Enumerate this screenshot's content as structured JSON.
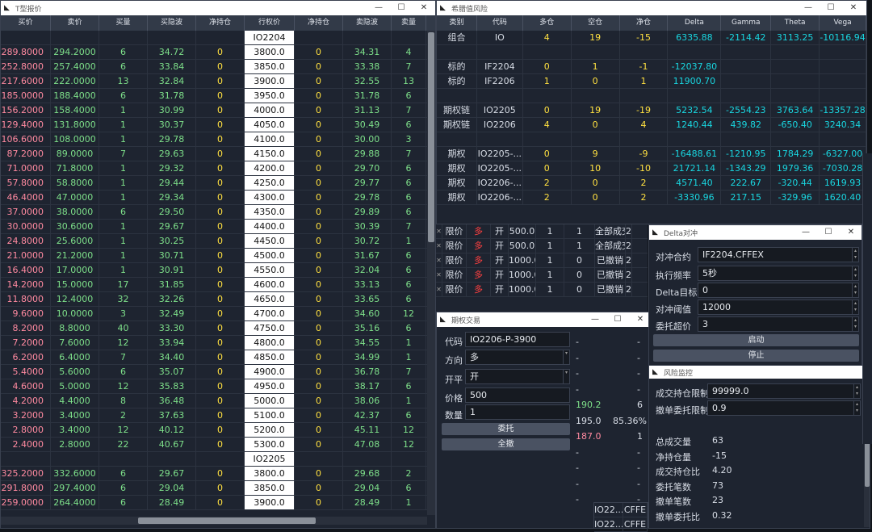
{
  "quote_window": {
    "title": "T型报价",
    "columns": [
      "买价",
      "卖价",
      "买量",
      "买隐波",
      "净持仓",
      "行权价",
      "净持仓",
      "卖隐波",
      "卖量"
    ],
    "rows": [
      {
        "bid": "",
        "ask": "",
        "bidvol": "",
        "biv": "",
        "pos": "",
        "strike": "IO2204",
        "pos2": "",
        "aiv": "",
        "askvol": "",
        "header": true
      },
      {
        "bid": "289.8000",
        "ask": "294.2000",
        "bidvol": "6",
        "biv": "34.72",
        "pos": "0",
        "strike": "3800.0",
        "pos2": "0",
        "aiv": "34.31",
        "askvol": "4"
      },
      {
        "bid": "252.8000",
        "ask": "257.4000",
        "bidvol": "6",
        "biv": "33.84",
        "pos": "0",
        "strike": "3850.0",
        "pos2": "0",
        "aiv": "33.38",
        "askvol": "7"
      },
      {
        "bid": "217.6000",
        "ask": "222.0000",
        "bidvol": "13",
        "biv": "32.84",
        "pos": "0",
        "strike": "3900.0",
        "pos2": "0",
        "aiv": "32.55",
        "askvol": "13"
      },
      {
        "bid": "185.0000",
        "ask": "188.4000",
        "bidvol": "6",
        "biv": "31.78",
        "pos": "0",
        "strike": "3950.0",
        "pos2": "0",
        "aiv": "31.78",
        "askvol": "6"
      },
      {
        "bid": "156.2000",
        "ask": "158.4000",
        "bidvol": "1",
        "biv": "30.99",
        "pos": "0",
        "strike": "4000.0",
        "pos2": "0",
        "aiv": "31.13",
        "askvol": "7"
      },
      {
        "bid": "129.4000",
        "ask": "131.8000",
        "bidvol": "1",
        "biv": "30.37",
        "pos": "0",
        "strike": "4050.0",
        "pos2": "0",
        "aiv": "30.49",
        "askvol": "6"
      },
      {
        "bid": "106.6000",
        "ask": "108.0000",
        "bidvol": "1",
        "biv": "29.78",
        "pos": "0",
        "strike": "4100.0",
        "pos2": "0",
        "aiv": "30.00",
        "askvol": "3"
      },
      {
        "bid": "87.2000",
        "ask": "89.0000",
        "bidvol": "7",
        "biv": "29.63",
        "pos": "0",
        "strike": "4150.0",
        "pos2": "0",
        "aiv": "29.88",
        "askvol": "7"
      },
      {
        "bid": "71.0000",
        "ask": "71.8000",
        "bidvol": "1",
        "biv": "29.32",
        "pos": "0",
        "strike": "4200.0",
        "pos2": "0",
        "aiv": "29.70",
        "askvol": "6"
      },
      {
        "bid": "57.8000",
        "ask": "58.8000",
        "bidvol": "1",
        "biv": "29.44",
        "pos": "0",
        "strike": "4250.0",
        "pos2": "0",
        "aiv": "29.77",
        "askvol": "6"
      },
      {
        "bid": "46.4000",
        "ask": "47.0000",
        "bidvol": "1",
        "biv": "29.34",
        "pos": "0",
        "strike": "4300.0",
        "pos2": "0",
        "aiv": "29.78",
        "askvol": "6"
      },
      {
        "bid": "37.0000",
        "ask": "38.0000",
        "bidvol": "6",
        "biv": "29.50",
        "pos": "0",
        "strike": "4350.0",
        "pos2": "0",
        "aiv": "29.89",
        "askvol": "6"
      },
      {
        "bid": "30.0000",
        "ask": "30.6000",
        "bidvol": "1",
        "biv": "29.67",
        "pos": "0",
        "strike": "4400.0",
        "pos2": "0",
        "aiv": "30.39",
        "askvol": "7"
      },
      {
        "bid": "24.8000",
        "ask": "25.6000",
        "bidvol": "1",
        "biv": "30.25",
        "pos": "0",
        "strike": "4450.0",
        "pos2": "0",
        "aiv": "30.72",
        "askvol": "1"
      },
      {
        "bid": "21.0000",
        "ask": "21.2000",
        "bidvol": "1",
        "biv": "30.71",
        "pos": "0",
        "strike": "4500.0",
        "pos2": "0",
        "aiv": "31.67",
        "askvol": "6"
      },
      {
        "bid": "16.4000",
        "ask": "17.0000",
        "bidvol": "1",
        "biv": "30.91",
        "pos": "0",
        "strike": "4550.0",
        "pos2": "0",
        "aiv": "32.04",
        "askvol": "6"
      },
      {
        "bid": "14.2000",
        "ask": "15.0000",
        "bidvol": "17",
        "biv": "31.85",
        "pos": "0",
        "strike": "4600.0",
        "pos2": "0",
        "aiv": "33.13",
        "askvol": "6"
      },
      {
        "bid": "11.8000",
        "ask": "12.4000",
        "bidvol": "32",
        "biv": "32.26",
        "pos": "0",
        "strike": "4650.0",
        "pos2": "0",
        "aiv": "33.65",
        "askvol": "6"
      },
      {
        "bid": "9.6000",
        "ask": "10.0000",
        "bidvol": "3",
        "biv": "32.49",
        "pos": "0",
        "strike": "4700.0",
        "pos2": "0",
        "aiv": "34.60",
        "askvol": "12"
      },
      {
        "bid": "8.2000",
        "ask": "8.8000",
        "bidvol": "40",
        "biv": "33.30",
        "pos": "0",
        "strike": "4750.0",
        "pos2": "0",
        "aiv": "35.16",
        "askvol": "6"
      },
      {
        "bid": "7.2000",
        "ask": "7.6000",
        "bidvol": "12",
        "biv": "33.94",
        "pos": "0",
        "strike": "4800.0",
        "pos2": "0",
        "aiv": "34.55",
        "askvol": "1"
      },
      {
        "bid": "6.2000",
        "ask": "6.4000",
        "bidvol": "7",
        "biv": "34.40",
        "pos": "0",
        "strike": "4850.0",
        "pos2": "0",
        "aiv": "34.99",
        "askvol": "1"
      },
      {
        "bid": "5.4000",
        "ask": "5.6000",
        "bidvol": "6",
        "biv": "35.07",
        "pos": "0",
        "strike": "4900.0",
        "pos2": "0",
        "aiv": "36.78",
        "askvol": "7"
      },
      {
        "bid": "4.6000",
        "ask": "5.0000",
        "bidvol": "12",
        "biv": "35.83",
        "pos": "0",
        "strike": "4950.0",
        "pos2": "0",
        "aiv": "38.17",
        "askvol": "6"
      },
      {
        "bid": "4.2000",
        "ask": "4.4000",
        "bidvol": "8",
        "biv": "36.48",
        "pos": "0",
        "strike": "5000.0",
        "pos2": "0",
        "aiv": "38.06",
        "askvol": "1"
      },
      {
        "bid": "3.2000",
        "ask": "3.4000",
        "bidvol": "2",
        "biv": "37.63",
        "pos": "0",
        "strike": "5100.0",
        "pos2": "0",
        "aiv": "42.37",
        "askvol": "6"
      },
      {
        "bid": "2.8000",
        "ask": "3.4000",
        "bidvol": "12",
        "biv": "40.12",
        "pos": "0",
        "strike": "5200.0",
        "pos2": "0",
        "aiv": "45.11",
        "askvol": "12"
      },
      {
        "bid": "2.4000",
        "ask": "2.8000",
        "bidvol": "22",
        "biv": "40.67",
        "pos": "0",
        "strike": "5300.0",
        "pos2": "0",
        "aiv": "47.08",
        "askvol": "12"
      },
      {
        "bid": "",
        "ask": "",
        "bidvol": "",
        "biv": "",
        "pos": "",
        "strike": "IO2205",
        "pos2": "",
        "aiv": "",
        "askvol": "",
        "header": true
      },
      {
        "bid": "325.2000",
        "ask": "332.6000",
        "bidvol": "6",
        "biv": "29.67",
        "pos": "0",
        "strike": "3800.0",
        "pos2": "0",
        "aiv": "29.68",
        "askvol": "2"
      },
      {
        "bid": "291.8000",
        "ask": "297.4000",
        "bidvol": "6",
        "biv": "29.04",
        "pos": "0",
        "strike": "3850.0",
        "pos2": "0",
        "aiv": "29.04",
        "askvol": "6"
      },
      {
        "bid": "259.0000",
        "ask": "264.4000",
        "bidvol": "6",
        "biv": "28.49",
        "pos": "0",
        "strike": "3900.0",
        "pos2": "0",
        "aiv": "28.49",
        "askvol": "1"
      }
    ]
  },
  "greeks_window": {
    "title": "希腊值风险",
    "columns": [
      "类别",
      "代码",
      "多仓",
      "空仓",
      "净仓",
      "Delta",
      "Gamma",
      "Theta",
      "Vega"
    ],
    "rows": [
      [
        "组合",
        "IO",
        "4",
        "19",
        "-15",
        "6335.88",
        "-2114.42",
        "3113.25",
        "-10116.94"
      ],
      [
        "",
        "",
        "",
        "",
        "",
        "",
        "",
        "",
        ""
      ],
      [
        "标的",
        "IF2204",
        "0",
        "1",
        "-1",
        "-12037.80",
        "",
        "",
        ""
      ],
      [
        "标的",
        "IF2206",
        "1",
        "0",
        "1",
        "11900.70",
        "",
        "",
        ""
      ],
      [
        "",
        "",
        "",
        "",
        "",
        "",
        "",
        "",
        ""
      ],
      [
        "期权链",
        "IO2205",
        "0",
        "19",
        "-19",
        "5232.54",
        "-2554.23",
        "3763.64",
        "-13357.28"
      ],
      [
        "期权链",
        "IO2206",
        "4",
        "0",
        "4",
        "1240.44",
        "439.82",
        "-650.40",
        "3240.34"
      ],
      [
        "",
        "",
        "",
        "",
        "",
        "",
        "",
        "",
        ""
      ],
      [
        "期权",
        "IO2205-...",
        "0",
        "9",
        "-9",
        "-16488.61",
        "-1210.95",
        "1784.29",
        "-6327.00"
      ],
      [
        "期权",
        "IO2205-...",
        "0",
        "10",
        "-10",
        "21721.14",
        "-1343.29",
        "1979.36",
        "-7030.28"
      ],
      [
        "期权",
        "IO2206-...",
        "2",
        "0",
        "2",
        "4571.40",
        "222.67",
        "-320.44",
        "1619.93"
      ],
      [
        "期权",
        "IO2206-...",
        "2",
        "0",
        "2",
        "-3330.96",
        "217.15",
        "-329.96",
        "1620.40"
      ]
    ]
  },
  "orders": {
    "rows": [
      [
        "限价",
        "多",
        "开",
        "500.0",
        "1",
        "1",
        "全部成交",
        "2"
      ],
      [
        "限价",
        "多",
        "开",
        "500.0",
        "1",
        "1",
        "全部成交",
        "2"
      ],
      [
        "限价",
        "多",
        "开",
        "1000.0",
        "1",
        "0",
        "已撤销",
        "2"
      ],
      [
        "限价",
        "多",
        "开",
        "1000.0",
        "1",
        "0",
        "已撤销",
        "2"
      ],
      [
        "限价",
        "多",
        "开",
        "1000.0",
        "1",
        "0",
        "已撤销",
        "2"
      ]
    ]
  },
  "trade_window": {
    "title": "期权交易",
    "code_label": "代码",
    "code": "IO2206-P-3900",
    "direction_label": "方向",
    "direction": "多",
    "offset_label": "开平",
    "offset": "开",
    "price_label": "价格",
    "price": "500",
    "volume_label": "数量",
    "volume": "1",
    "send_button": "委托",
    "cancel_all_button": "全撤",
    "depth": [
      [
        "-",
        "-"
      ],
      [
        "-",
        "-"
      ],
      [
        "-",
        "-"
      ],
      [
        "-",
        "-"
      ],
      [
        "190.2",
        "6"
      ],
      [
        "195.0",
        "85.36%"
      ],
      [
        "187.0",
        "1"
      ],
      [
        "-",
        "-"
      ],
      [
        "-",
        "-"
      ],
      [
        "-",
        "-"
      ],
      [
        "-",
        "-"
      ]
    ]
  },
  "hedge_window": {
    "title": "Delta对冲",
    "symbol_label": "对冲合约",
    "symbol": "IF2204.CFFEX",
    "freq_label": "执行频率",
    "freq": "5秒",
    "target_label": "Delta目标",
    "target": "0",
    "threshold_label": "对冲阈值",
    "threshold": "12000",
    "payup_label": "委托超价",
    "payup": "3",
    "start_button": "启动",
    "stop_button": "停止"
  },
  "risk_window": {
    "title": "风险监控",
    "trade_limit_label": "成交持仓限制",
    "trade_limit": "99999.0",
    "cancel_limit_label": "撤单委托限制",
    "cancel_limit": "0.9",
    "stats": [
      {
        "label": "总成交量",
        "value": "63"
      },
      {
        "label": "净持仓量",
        "value": "-15"
      },
      {
        "label": "成交持仓比",
        "value": "4.20"
      },
      {
        "label": "委托笔数",
        "value": "73"
      },
      {
        "label": "撤单笔数",
        "value": "23"
      },
      {
        "label": "撤单委托比",
        "value": "0.32"
      }
    ]
  },
  "bottom_fragment": {
    "rows": [
      [
        "IO22...",
        "CFFE"
      ],
      [
        "IO22...",
        "CFFE"
      ]
    ]
  },
  "colors": {
    "buy": "#ff8aa0",
    "sell": "#7ee08a",
    "position": "#ffe040",
    "greek": "#19d6e0",
    "bg": "#1e2430"
  }
}
